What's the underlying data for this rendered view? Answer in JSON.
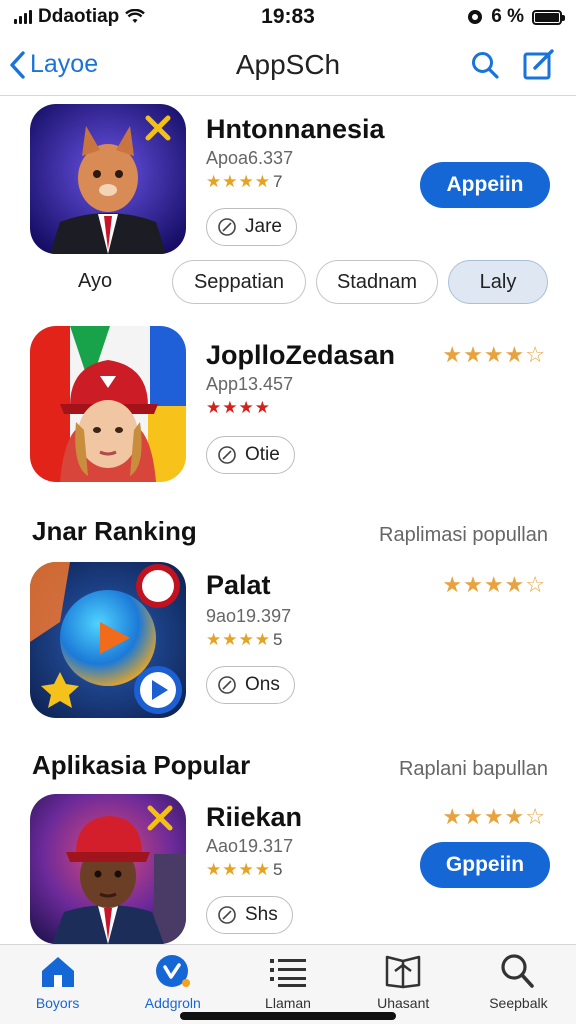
{
  "status": {
    "carrier": "Ddaotiap",
    "time": "19:83",
    "battery": "6 %"
  },
  "nav": {
    "back_label": "Layoe",
    "title": "AppSCh"
  },
  "apps": [
    {
      "name": "Hntonnanesia",
      "meta": "Apoa6.337",
      "small_rating": "★★★★",
      "small_num": "7",
      "tag": "Jare",
      "open_label": "Appeiin",
      "big_rating": ""
    },
    {
      "name": "JoplloZedasan",
      "meta": "App13.457",
      "small_rating": "★★★★",
      "small_num": "",
      "tag": "Otie",
      "open_label": "",
      "big_rating": "★★★★☆"
    },
    {
      "name": "Palat",
      "meta": "9ao19.397",
      "small_rating": "★★★★",
      "small_num": "5",
      "tag": "Ons",
      "open_label": "",
      "big_rating": "★★★★☆"
    },
    {
      "name": "Riiekan",
      "meta": "Aao19.317",
      "small_rating": "★★★★",
      "small_num": "5",
      "tag": "Shs",
      "open_label": "Gppeiin",
      "big_rating": "★★★★☆"
    }
  ],
  "filters": {
    "plain": "Ayo",
    "chips": [
      "Seppatian",
      "Stadnam",
      "Laly"
    ],
    "active_index": 2
  },
  "sections": [
    {
      "title": "Jnar Ranking",
      "link": "Raplimasi popullan"
    },
    {
      "title": "Aplikasia Popular",
      "link": "Raplani bapullan"
    }
  ],
  "tabs": [
    {
      "label": "Boyors",
      "icon": "home-icon",
      "active": true
    },
    {
      "label": "Addgroln",
      "icon": "app-store-icon",
      "active": true
    },
    {
      "label": "Llaman",
      "icon": "list-icon",
      "active": false
    },
    {
      "label": "Uhasant",
      "icon": "book-icon",
      "active": false
    },
    {
      "label": "Seepbalk",
      "icon": "search-icon",
      "active": false
    }
  ],
  "colors": {
    "accent": "#1667d6",
    "star": "#e8a33e",
    "active_chip": "#dfe8f2"
  }
}
